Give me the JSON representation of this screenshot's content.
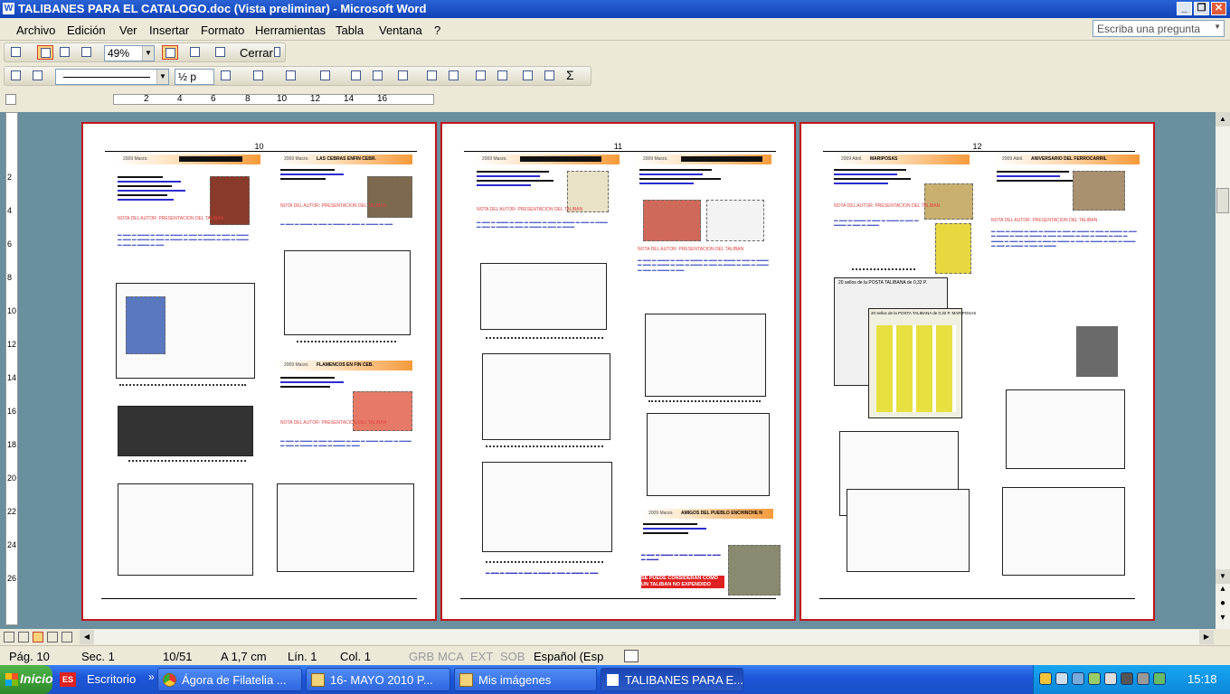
{
  "window": {
    "title": "TALIBANES PARA EL CATALOGO.doc (Vista preliminar) - Microsoft Word",
    "app_icon": "word-doc-icon"
  },
  "window_controls": {
    "minimize": "_",
    "restore": "❐",
    "close": "✕"
  },
  "menu": {
    "items": [
      "Archivo",
      "Edición",
      "Ver",
      "Insertar",
      "Formato",
      "Herramientas",
      "Tabla",
      "Ventana",
      "?"
    ],
    "ask_placeholder": "Escriba una pregunta"
  },
  "preview_toolbar": {
    "zoom": "49%",
    "close_label": "Cerrar"
  },
  "drawing_toolbar": {
    "size": "½ p"
  },
  "ruler": {
    "h_numbers": [
      "2",
      "4",
      "6",
      "8",
      "10",
      "12",
      "14",
      "16"
    ],
    "v_numbers": [
      "2",
      "4",
      "6",
      "8",
      "10",
      "12",
      "14",
      "16",
      "18",
      "20",
      "22",
      "24",
      "26"
    ]
  },
  "pages": [
    {
      "number": "10",
      "sections": [
        {
          "date": "2009 Marzo.",
          "title": ""
        },
        {
          "date": "2009 Marzo.",
          "title": "LAS CEBRAS ENFIN CEBR."
        },
        {
          "date": "2009 Marzo.",
          "title": "FLAMENCOS EN FIN CEB."
        }
      ],
      "notes": [
        "NOTA DEL AUTOR: PRESENTACION DEL TALIBAN",
        "NOTA DEL AUTOR: PRESENTACION DEL TALIBAN",
        "NOTA DEL AUTOR: PRESENTACION DEL TALIBAN"
      ]
    },
    {
      "number": "11",
      "sections": [
        {
          "date": "2009 Marzo.",
          "title": ""
        },
        {
          "date": "2009 Marzo.",
          "title": ""
        },
        {
          "date": "2009 Marzo.",
          "title": "AMIGOS DEL PUEBLO ENCHINCHE N"
        }
      ],
      "notes": [
        "NOTA DEL AUTOR: PRESENTACION DEL TALIBAN",
        "NOTA DEL AUTOR: PRESENTACION DEL TALIBAN"
      ],
      "alert": "SE PUEDE CONSIDERAN COMO UN TALIBAN NO EXPENDIDO"
    },
    {
      "number": "12",
      "sections": [
        {
          "date": "2009 Abril.",
          "title": "MARIPOSAS"
        },
        {
          "date": "2009 Abril.",
          "title": "ANIVERSARIO DEL FERROCARRIL"
        }
      ],
      "notes": [
        "NOTA DEL AUTOR: PRESENTACION DEL TALIBAN",
        "NOTA DEL AUTOR: PRESENTACION DEL TALIBAN"
      ],
      "sheet_titles": [
        "20 sellos de la POSTA TALIBANA de 0,32 P.",
        "20 sellos de la POSTA TALIBANA de 0,32 P. MARIPOSAS"
      ]
    }
  ],
  "status": {
    "page": "Pág. 10",
    "section": "Sec. 1",
    "pages": "10/51",
    "at": "A 1,7 cm",
    "line": "Lín. 1",
    "col": "Col. 1",
    "grb": "GRB",
    "mca": "MCA",
    "ext": "EXT",
    "sob": "SOB",
    "language": "Español (Esp"
  },
  "taskbar": {
    "start": "Inicio",
    "quicklaunch": "Escritorio",
    "tasks": [
      {
        "label": "Ágora de Filatelia ...",
        "icon": "chrome-icon"
      },
      {
        "label": "16- MAYO 2010  P...",
        "icon": "folder-icon"
      },
      {
        "label": "Mis imágenes",
        "icon": "folder-icon"
      },
      {
        "label": "TALIBANES PARA E...",
        "icon": "word-doc-icon"
      }
    ],
    "clock": "15:18"
  },
  "colors": {
    "titlebar": "#1142b8",
    "page_border": "#c0141b",
    "workspace": "#6a8f9e",
    "taskbar": "#1d57d8"
  }
}
